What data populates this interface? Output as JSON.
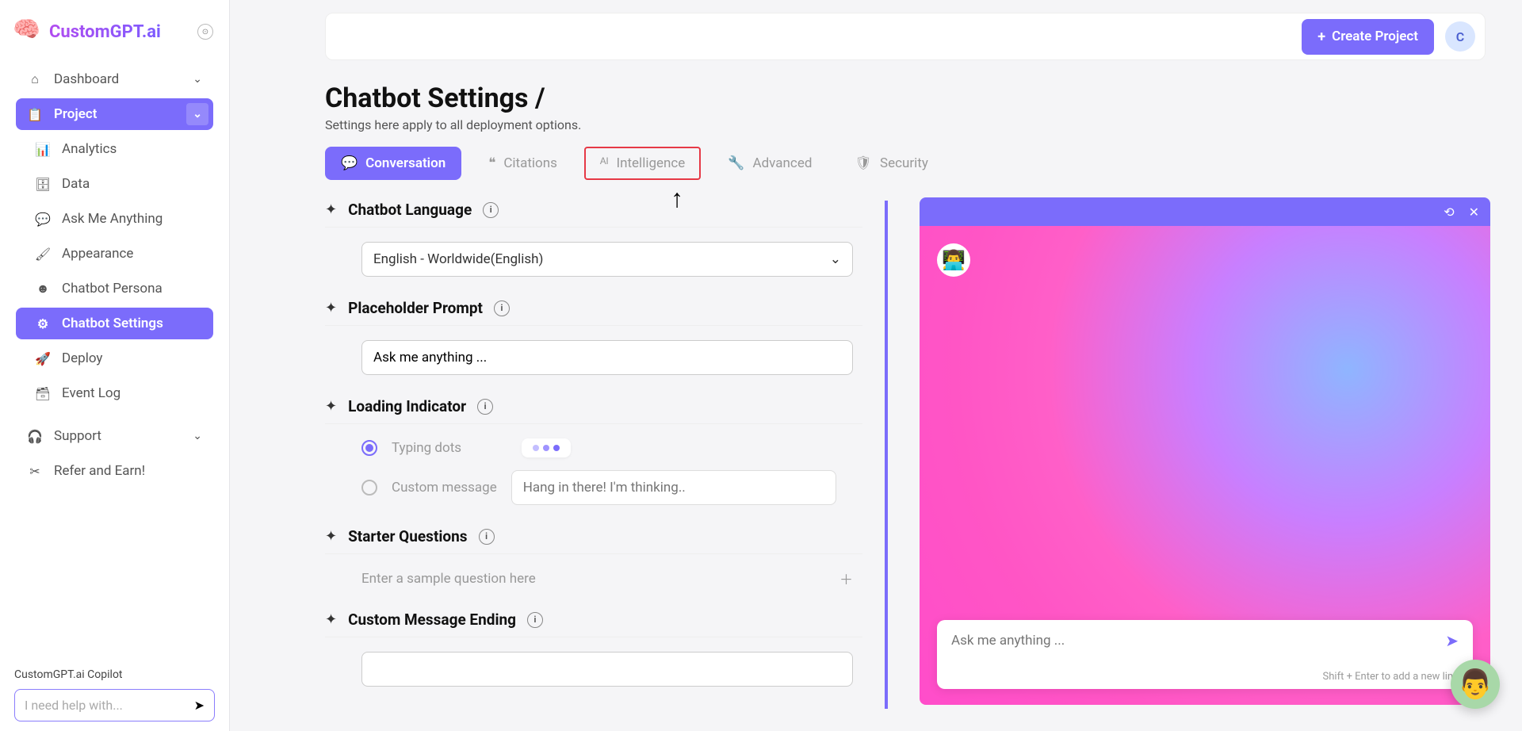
{
  "brand": "CustomGPT.ai",
  "sidebar": {
    "dashboard": "Dashboard",
    "project": "Project",
    "items": [
      "Analytics",
      "Data",
      "Ask Me Anything",
      "Appearance",
      "Chatbot Persona",
      "Chatbot Settings",
      "Deploy",
      "Event Log"
    ],
    "support": "Support",
    "refer": "Refer and Earn!"
  },
  "copilot": {
    "label": "CustomGPT.ai Copilot",
    "placeholder": "I need help with..."
  },
  "topbar": {
    "create": "Create Project",
    "avatar": "C"
  },
  "page": {
    "title": "Chatbot Settings /",
    "sub": "Settings here apply to all deployment options."
  },
  "tabs": [
    "Conversation",
    "Citations",
    "Intelligence",
    "Advanced",
    "Security"
  ],
  "sections": {
    "lang": {
      "title": "Chatbot Language",
      "value": "English - Worldwide(English)"
    },
    "placeholder": {
      "title": "Placeholder Prompt",
      "value": "Ask me anything ..."
    },
    "loading": {
      "title": "Loading Indicator",
      "opt1": "Typing dots",
      "opt2": "Custom message",
      "custom_ph": "Hang in there! I'm thinking.."
    },
    "starter": {
      "title": "Starter Questions",
      "ph": "Enter a sample question here"
    },
    "ending": {
      "title": "Custom Message Ending"
    }
  },
  "preview": {
    "input_ph": "Ask me anything ...",
    "hint": "Shift + Enter to add a new line"
  }
}
